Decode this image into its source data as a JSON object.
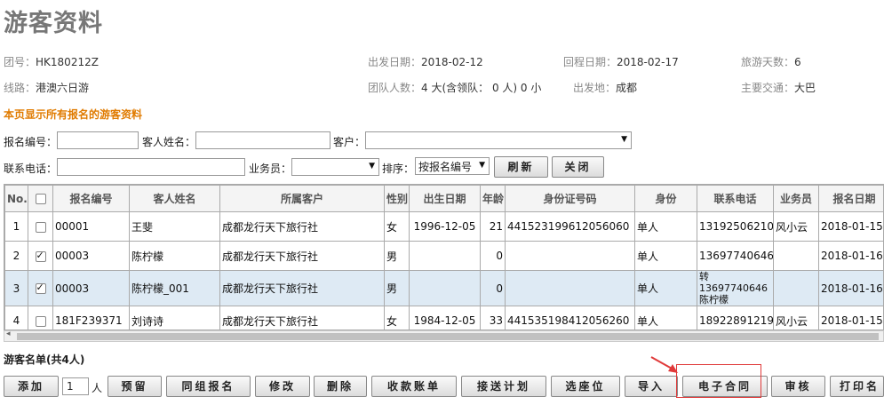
{
  "page_title": "游客资料",
  "info": {
    "tour_no_label": "团号：",
    "tour_no": "HK180212Z",
    "depart_label": "出发日期：",
    "depart": "2018-02-12",
    "return_label": "回程日期：",
    "return": "2018-02-17",
    "days_label": "旅游天数：",
    "days": "6",
    "route_label": "线路：",
    "route": "港澳六日游",
    "team_label": "团队人数：",
    "team": "4 大(含领队： 0 人) 0 小",
    "origin_label": "出发地：",
    "origin": "成都",
    "transport_label": "主要交通：",
    "transport": "大巴"
  },
  "notice": "本页显示所有报名的游客资料",
  "filters": {
    "reg_no_label": "报名编号：",
    "guest_name_label": "客人姓名：",
    "customer_label": "客户：",
    "phone_label": "联系电话：",
    "staff_label": "业务员：",
    "sort_label": "排序：",
    "sort_value": "按报名编号",
    "refresh_label": "刷新",
    "close_label": "关闭"
  },
  "table": {
    "headers": [
      "No.",
      "",
      "报名编号",
      "客人姓名",
      "所属客户",
      "性别",
      "出生日期",
      "年龄",
      "身份证号码",
      "身份",
      "联系电话",
      "业务员",
      "报名日期"
    ],
    "rows": [
      {
        "no": "1",
        "checked": false,
        "reg": "00001",
        "name": "王斐",
        "customer": "成都龙行天下旅行社",
        "gender": "女",
        "birth": "1996-12-05",
        "age": "21",
        "id": "441523199612056060",
        "role": "单人",
        "phone": "13192506210",
        "staff": "风小云",
        "date": "2018-01-15"
      },
      {
        "no": "2",
        "checked": true,
        "reg": "00003",
        "name": "陈柠檬",
        "customer": "成都龙行天下旅行社",
        "gender": "男",
        "birth": "",
        "age": "0",
        "id": "",
        "role": "单人",
        "phone": "13697740646",
        "staff": "",
        "date": "2018-01-16"
      },
      {
        "no": "3",
        "checked": true,
        "reg": "00003",
        "name": "陈柠檬_001",
        "customer": "成都龙行天下旅行社",
        "gender": "男",
        "birth": "",
        "age": "0",
        "id": "",
        "role": "单人",
        "phone": "转13697740646陈柠檬",
        "staff": "",
        "date": "2018-01-16"
      },
      {
        "no": "4",
        "checked": false,
        "reg": "181F239371",
        "name": "刘诗诗",
        "customer": "成都龙行天下旅行社",
        "gender": "女",
        "birth": "1984-12-05",
        "age": "33",
        "id": "441535198412056260",
        "role": "单人",
        "phone": "18922891219",
        "staff": "风小云",
        "date": "2018-01-15"
      }
    ]
  },
  "list_title": "游客名单(共4人)",
  "bottom": {
    "add": "添加",
    "qty": "1",
    "unit": "人",
    "reserve": "预留",
    "group_reg": "同组报名",
    "edit": "修改",
    "delete": "删除",
    "payment": "收款账单",
    "transfer": "接送计划",
    "seat": "选座位",
    "import": "导入",
    "contract": "电子合同",
    "audit": "审核",
    "print": "打印名"
  },
  "colors": {
    "accent": "#e07b00",
    "highlight": "#e03a3a",
    "selected_row": "#deeaf4"
  }
}
